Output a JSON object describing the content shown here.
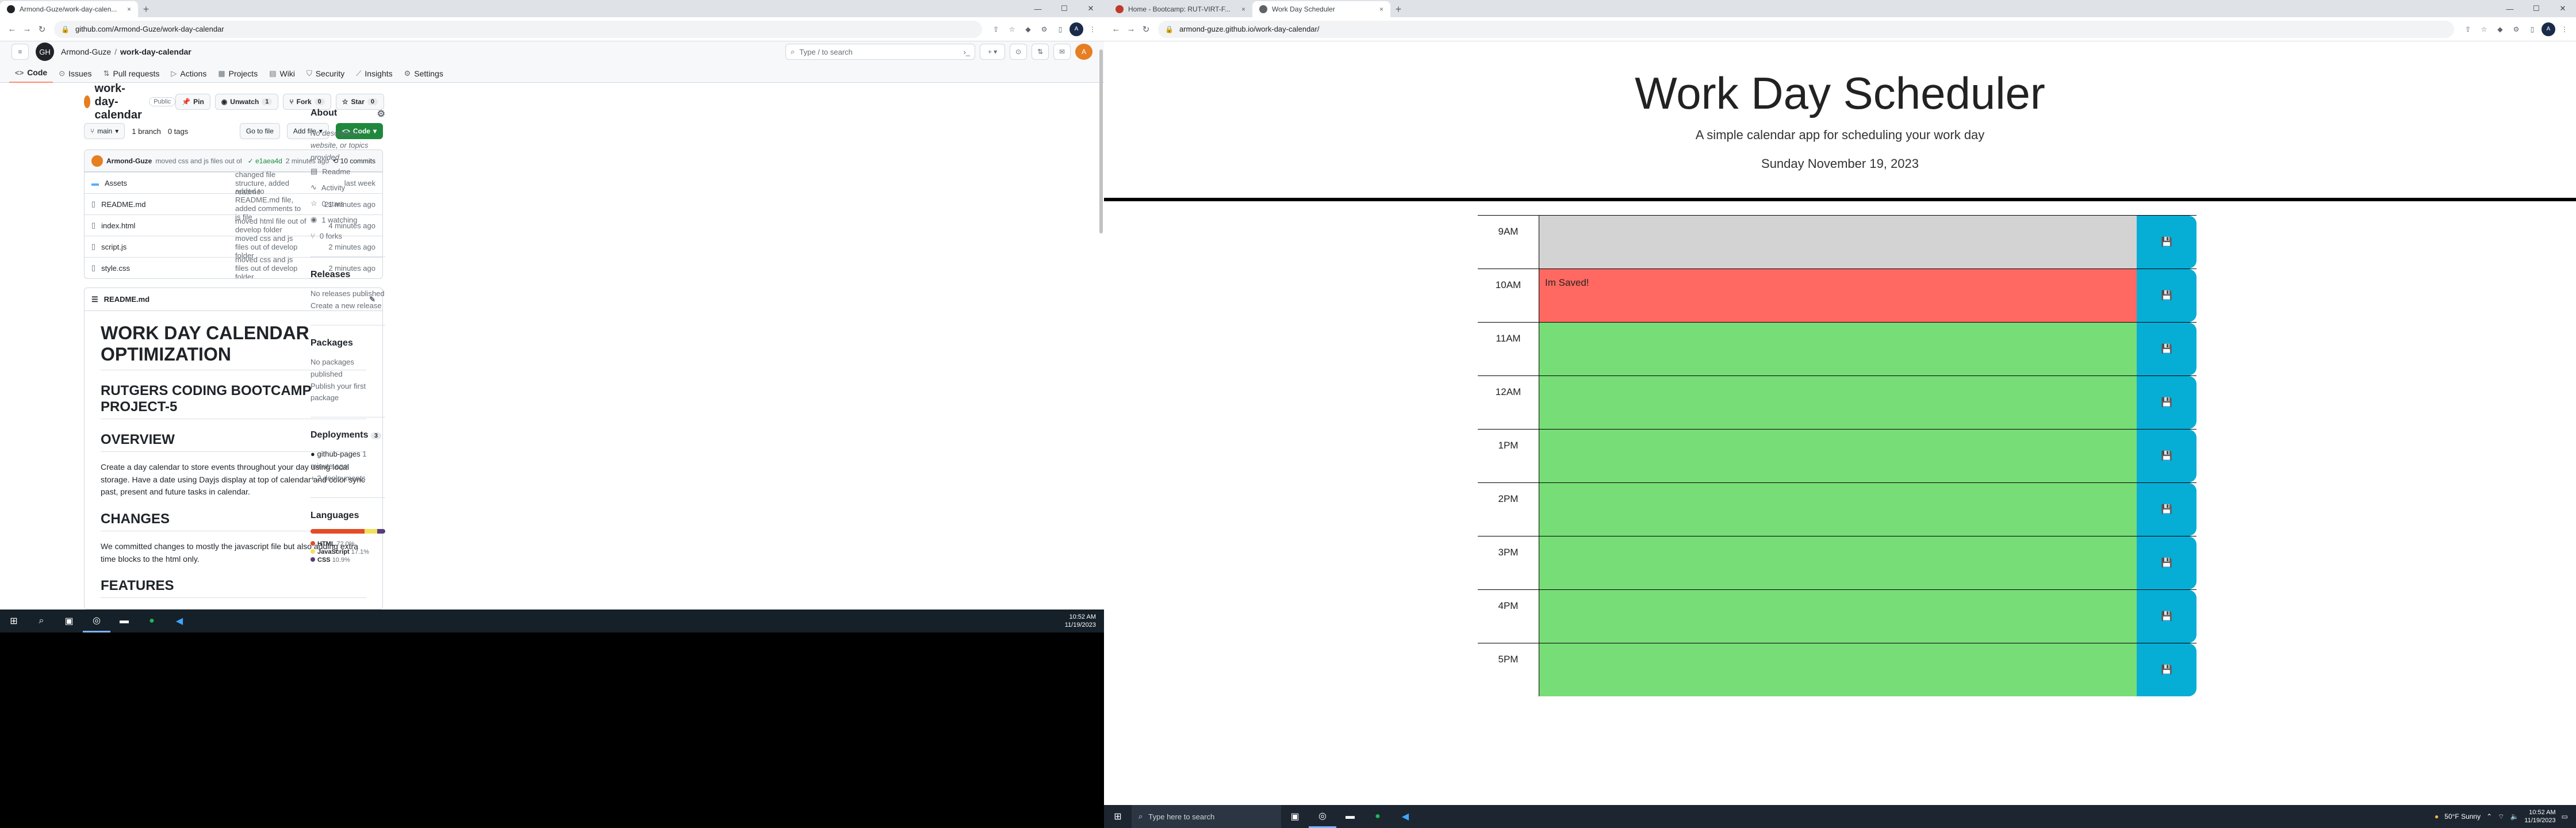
{
  "left": {
    "tabs": [
      {
        "title": "Armond-Guze/work-day-calen...",
        "close": "×"
      }
    ],
    "window": {
      "minimize": "—",
      "maximize": "☐",
      "close": "✕"
    },
    "url": "github.com/Armond-Guze/work-day-calendar",
    "github": {
      "owner": "Armond-Guze",
      "separator": "/",
      "repo": "work-day-calendar",
      "search_placeholder": "Type / to search",
      "tabs": [
        "Code",
        "Issues",
        "Pull requests",
        "Actions",
        "Projects",
        "Wiki",
        "Security",
        "Insights",
        "Settings"
      ],
      "repo_title": "work-day-calendar",
      "visibility": "Public",
      "pin": "Pin",
      "unwatch": "Unwatch",
      "unwatch_count": "1",
      "fork": "Fork",
      "fork_count": "0",
      "star": "Star",
      "star_count": "0",
      "branch": "main",
      "branches": "1 branch",
      "tags": "0 tags",
      "goto_file": "Go to file",
      "add_file": "Add file",
      "code_btn": "Code",
      "commit_author": "Armond-Guze",
      "commit_msg": "moved css and js files out of develop folder",
      "commit_hash": "✓ e1aea4d",
      "commit_time": "2 minutes ago",
      "commits": "10 commits",
      "files": [
        {
          "name": "Assets",
          "msg": "changed file structure, added readme",
          "time": "last week",
          "type": "dir"
        },
        {
          "name": "README.md",
          "msg": "added to README.md file, added comments to js file",
          "time": "21 minutes ago",
          "type": "file"
        },
        {
          "name": "index.html",
          "msg": "moved html file out of develop folder",
          "time": "4 minutes ago",
          "type": "file"
        },
        {
          "name": "script.js",
          "msg": "moved css and js files out of develop folder",
          "time": "2 minutes ago",
          "type": "file"
        },
        {
          "name": "style.css",
          "msg": "moved css and js files out of develop folder",
          "time": "2 minutes ago",
          "type": "file"
        }
      ],
      "readme": {
        "filename": "README.md",
        "h1": "WORK DAY CALENDAR OPTIMIZATION",
        "h2a": "RUTGERS CODING BOOTCAMP PROJECT-5",
        "h2b": "OVERVIEW",
        "p1": "Create a day calendar to store events throughout your day using local storage. Have a date using Dayjs display at top of calendar and color sync past, present and future tasks in calendar.",
        "h2c": "CHANGES",
        "p2": "We committed changes to mostly the javascript file but also adding extra time blocks to the html only.",
        "h2d": "FEATURES"
      },
      "about": {
        "title": "About",
        "desc": "No description, website, or topics provided.",
        "items": [
          "Readme",
          "Activity",
          "0 stars",
          "1 watching",
          "0 forks"
        ]
      },
      "releases": {
        "title": "Releases",
        "none": "No releases published",
        "link": "Create a new release"
      },
      "packages": {
        "title": "Packages",
        "none": "No packages published",
        "link": "Publish your first package"
      },
      "deployments": {
        "title": "Deployments",
        "count": "3",
        "item": "github-pages",
        "time": "1 minute ago",
        "more": "+ 2 deployments"
      },
      "languages": {
        "title": "Languages",
        "list": [
          {
            "name": "HTML",
            "pct": "72.0%",
            "value": 72.0,
            "color": "#e34c26"
          },
          {
            "name": "JavaScript",
            "pct": "17.1%",
            "value": 17.1,
            "color": "#f1e05a"
          },
          {
            "name": "CSS",
            "pct": "10.9%",
            "value": 10.9,
            "color": "#563d7c"
          }
        ]
      }
    },
    "clock": {
      "time": "10:52 AM",
      "date": "11/19/2023"
    }
  },
  "right": {
    "tabs": [
      {
        "title": "Home - Bootcamp: RUT-VIRT-F...",
        "close": "×"
      },
      {
        "title": "Work Day Scheduler",
        "close": "×"
      }
    ],
    "url": "armond-guze.github.io/work-day-calendar/",
    "app": {
      "title": "Work Day Scheduler",
      "lead": "A simple calendar app for scheduling your work day",
      "date": "Sunday November 19, 2023",
      "save_icon": "💾",
      "blocks": [
        {
          "hour": "9AM",
          "text": "",
          "state": "past"
        },
        {
          "hour": "10AM",
          "text": "Im Saved!",
          "state": "present"
        },
        {
          "hour": "11AM",
          "text": "",
          "state": "future"
        },
        {
          "hour": "12AM",
          "text": "",
          "state": "future"
        },
        {
          "hour": "1PM",
          "text": "",
          "state": "future"
        },
        {
          "hour": "2PM",
          "text": "",
          "state": "future"
        },
        {
          "hour": "3PM",
          "text": "",
          "state": "future"
        },
        {
          "hour": "4PM",
          "text": "",
          "state": "future"
        },
        {
          "hour": "5PM",
          "text": "",
          "state": "future"
        }
      ]
    },
    "taskbar": {
      "search_placeholder": "Type here to search"
    },
    "weather": "50°F  Sunny",
    "clock": {
      "time": "10:52 AM",
      "date": "11/19/2023"
    }
  },
  "colors": {
    "past": "#d3d3d3",
    "present": "#ff6961",
    "future": "#77dd77",
    "save": "#06aed5"
  }
}
